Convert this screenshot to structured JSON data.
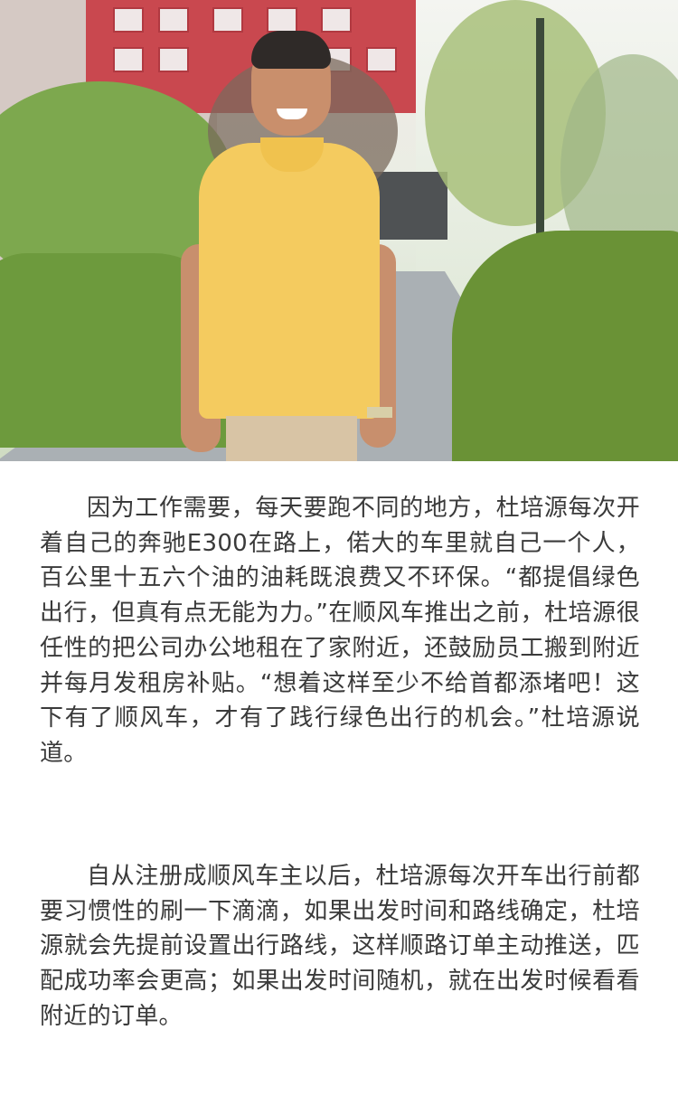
{
  "photo": {
    "subject": "man in yellow polo shirt smiling on a garden path"
  },
  "article": {
    "paragraphs": [
      "因为工作需要，每天要跑不同的地方，杜培源每次开着自己的奔驰E300在路上，偌大的车里就自己一个人，百公里十五六个油的油耗既浪费又不环保。“都提倡绿色出行，但真有点无能为力。”在顺风车推出之前，杜培源很任性的把公司办公地租在了家附近，还鼓励员工搬到附近并每月发租房补贴。“想着这样至少不给首都添堵吧！这下有了顺风车，才有了践行绿色出行的机会。”杜培源说道。",
      "自从注册成顺风车主以后，杜培源每次开车出行前都要习惯性的刷一下滴滴，如果出发时间和路线确定，杜培源就会先提前设置出行路线，这样顺路订单主动推送，匹配成功率会更高；如果出发时间随机，就在出发时候看看附近的订单。"
    ]
  }
}
